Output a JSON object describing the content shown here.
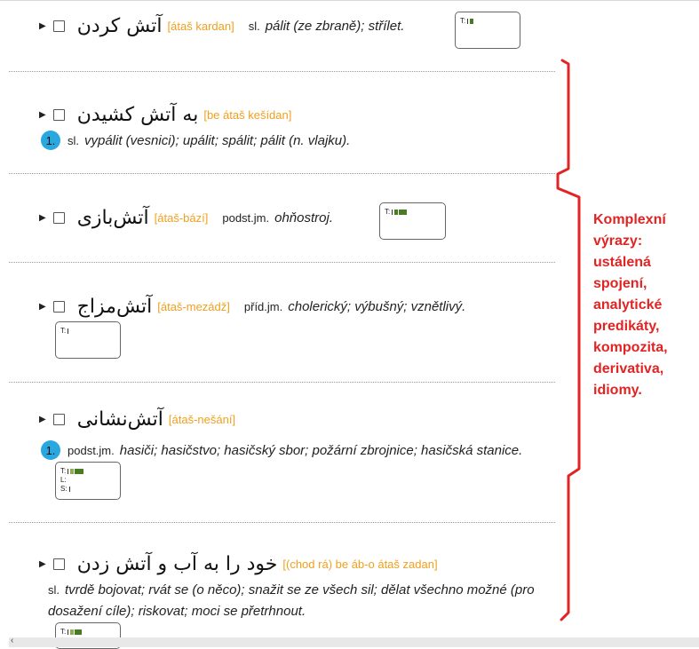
{
  "entries": [
    {
      "persian": "آتش کردن",
      "translit": "[átaš kardan]",
      "pos": "sl.",
      "translation": "pálit (ze zbraně); střílet.",
      "t": "T:"
    },
    {
      "persian": "به آتش کشیدن",
      "translit": "[be átaš kešídan]",
      "number": "1.",
      "pos": "sl.",
      "translation": "vypálit (vesnici); upálit; spálit; pálit (n. vlajku)."
    },
    {
      "persian": "آتش‌بازی",
      "translit": "[átaš-bází]",
      "pos": "podst.jm.",
      "translation": "ohňostroj.",
      "t": "T:"
    },
    {
      "persian": "آتش‌مزاج",
      "translit": "[átaš-mezádž]",
      "pos": "příd.jm.",
      "translation": "cholerický; výbušný; vznětlivý.",
      "t": "T:"
    },
    {
      "persian": "آتش‌نشانی",
      "translit": "[átaš-nešání]",
      "number": "1.",
      "pos": "podst.jm.",
      "translation": "hasiči; hasičstvo; hasičský sbor; požární zbrojnice; hasičská stanice.",
      "t": "T:",
      "l": "L:",
      "s": "S:"
    },
    {
      "persian": "خود را به آب و آتش زدن",
      "translit": "[(chod rá) be áb-o átaš zadan]",
      "pos": "sl.",
      "translation_line1": "tvrdě bojovat; rvát se (o něco); snažit se ze všech sil; dělat všechno možné (pro",
      "translation_line2": "dosažení cíle); riskovat; moci se přetrhnout.",
      "t": "T:"
    }
  ],
  "annotation": {
    "line1": "Komplexní",
    "line2": "výrazy:",
    "line3": "ustálená",
    "line4": "spojení,",
    "line5": "analytické",
    "line6": "predikáty,",
    "line7": "kompozita,",
    "line8": "derivativa,",
    "line9": "idiomy.",
    "color": "#e02424"
  },
  "icons": {
    "expand": "triangle-right-icon",
    "checkbox": "checkbox-icon",
    "back": "chevron-left-icon"
  }
}
